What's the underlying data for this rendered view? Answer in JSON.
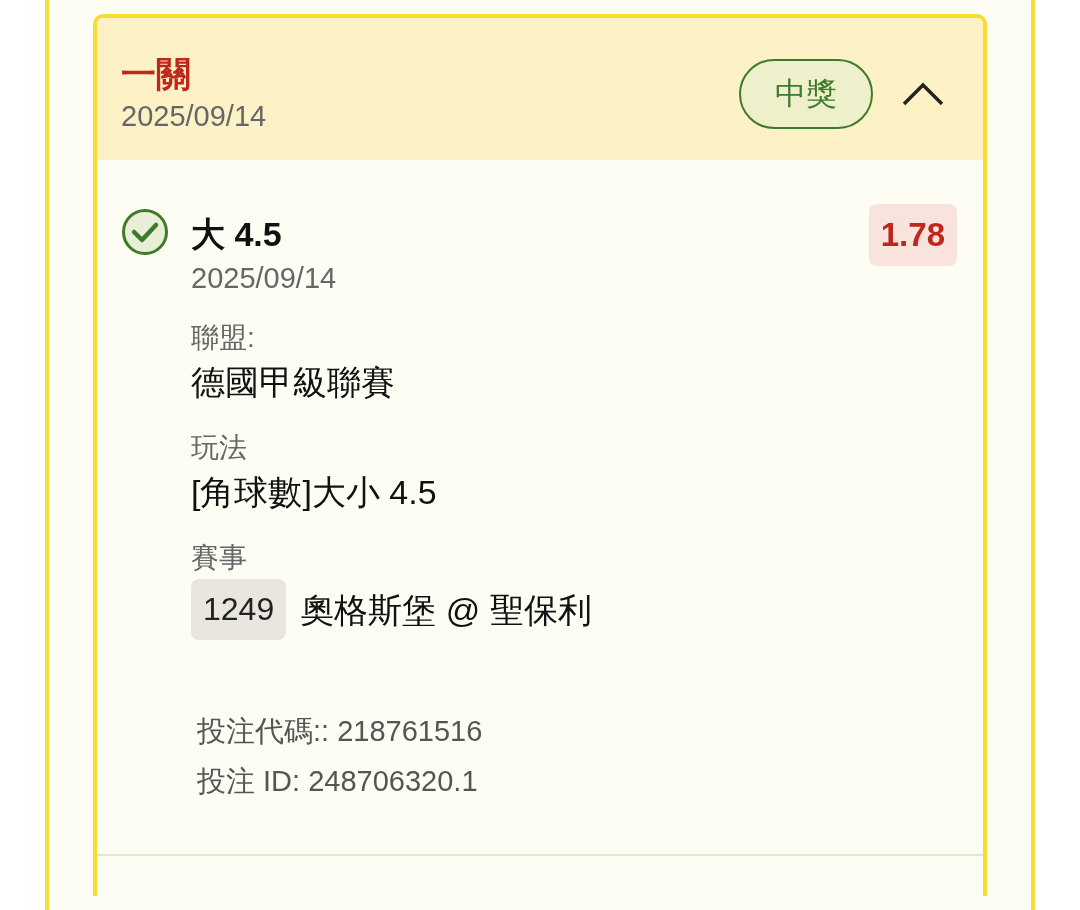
{
  "bet": {
    "title": "一關",
    "date": "2025/09/14",
    "status": {
      "label": "中獎",
      "kind": "won"
    },
    "expanded": true
  },
  "selection": {
    "won": true,
    "pick": "大 4.5",
    "date": "2025/09/14",
    "odds": "1.78"
  },
  "fields": [
    {
      "label": "聯盟:",
      "value": "德國甲級聯賽"
    },
    {
      "label": "玩法",
      "value": "[角球數]大小 4.5"
    },
    {
      "label": "賽事",
      "match_no": "1249",
      "value": "奧格斯堡 @ 聖保利"
    }
  ],
  "footer": [
    "投注代碼:: 218761516",
    "投注 ID: 248706320.1"
  ]
}
